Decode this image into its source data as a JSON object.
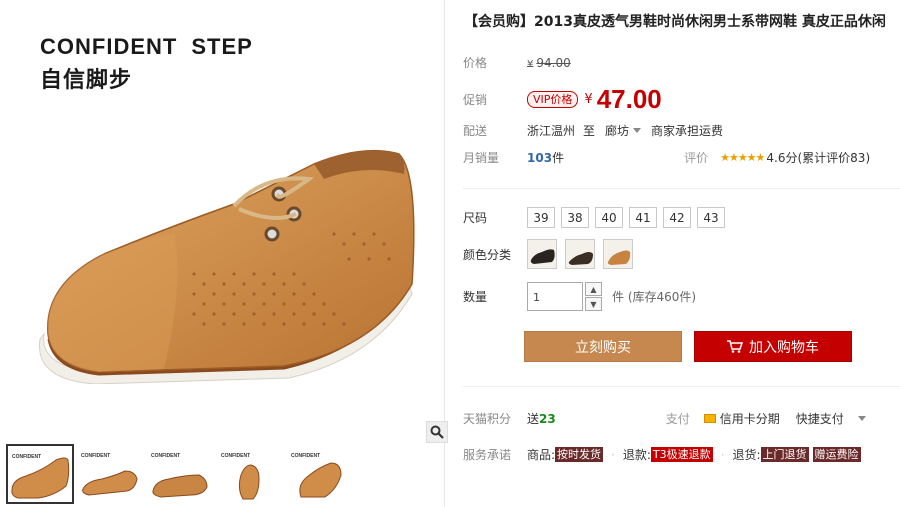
{
  "brand": {
    "en_word1": "CONFIDENT",
    "en_word2": "STEP",
    "cn": "自信脚步"
  },
  "product": {
    "title": "【会员购】2013真皮透气男鞋时尚休闲男士系带网鞋 真皮正品休闲"
  },
  "price_section": {
    "price_label": "价格",
    "original_currency": "¥",
    "original_price": "94.00",
    "promo_label": "促销",
    "vip_tag": "VIP价格",
    "promo_currency": "¥",
    "promo_price": "47.00"
  },
  "shipping": {
    "label": "配送",
    "from": "浙江温州",
    "to_word": "至",
    "destination": "廊坊",
    "fee_text": "商家承担运费"
  },
  "sales": {
    "label": "月销量",
    "count": "103",
    "unit": "件",
    "rating_label": "评价",
    "stars": "★★★★★",
    "score_text": "4.6分(累计评价83)"
  },
  "size": {
    "label": "尺码",
    "options": [
      "39",
      "38",
      "40",
      "41",
      "42",
      "43"
    ]
  },
  "color": {
    "label": "颜色分类"
  },
  "quantity": {
    "label": "数量",
    "value": "1",
    "stock_text": "件 (库存460件)",
    "up": "▲",
    "down": "▼"
  },
  "buttons": {
    "buy_now": "立刻购买",
    "add_to_cart": "加入购物车"
  },
  "points": {
    "label": "天猫积分",
    "send_word": "送",
    "value": "23",
    "pay_label": "支付",
    "credit_card": "信用卡分期",
    "quick_pay": "快捷支付"
  },
  "service": {
    "label": "服务承诺",
    "goods_label": "商品:",
    "goods_tag": "按时发货",
    "refund_label": "退款:",
    "refund_tag": "T3极速退款",
    "return_label": "退货:",
    "return_tag1": "上门退货",
    "return_tag2": "赠运费险"
  },
  "colors": {
    "accent": "#c40000",
    "buy_button": "#c7884f",
    "rating": "#e8a000"
  }
}
